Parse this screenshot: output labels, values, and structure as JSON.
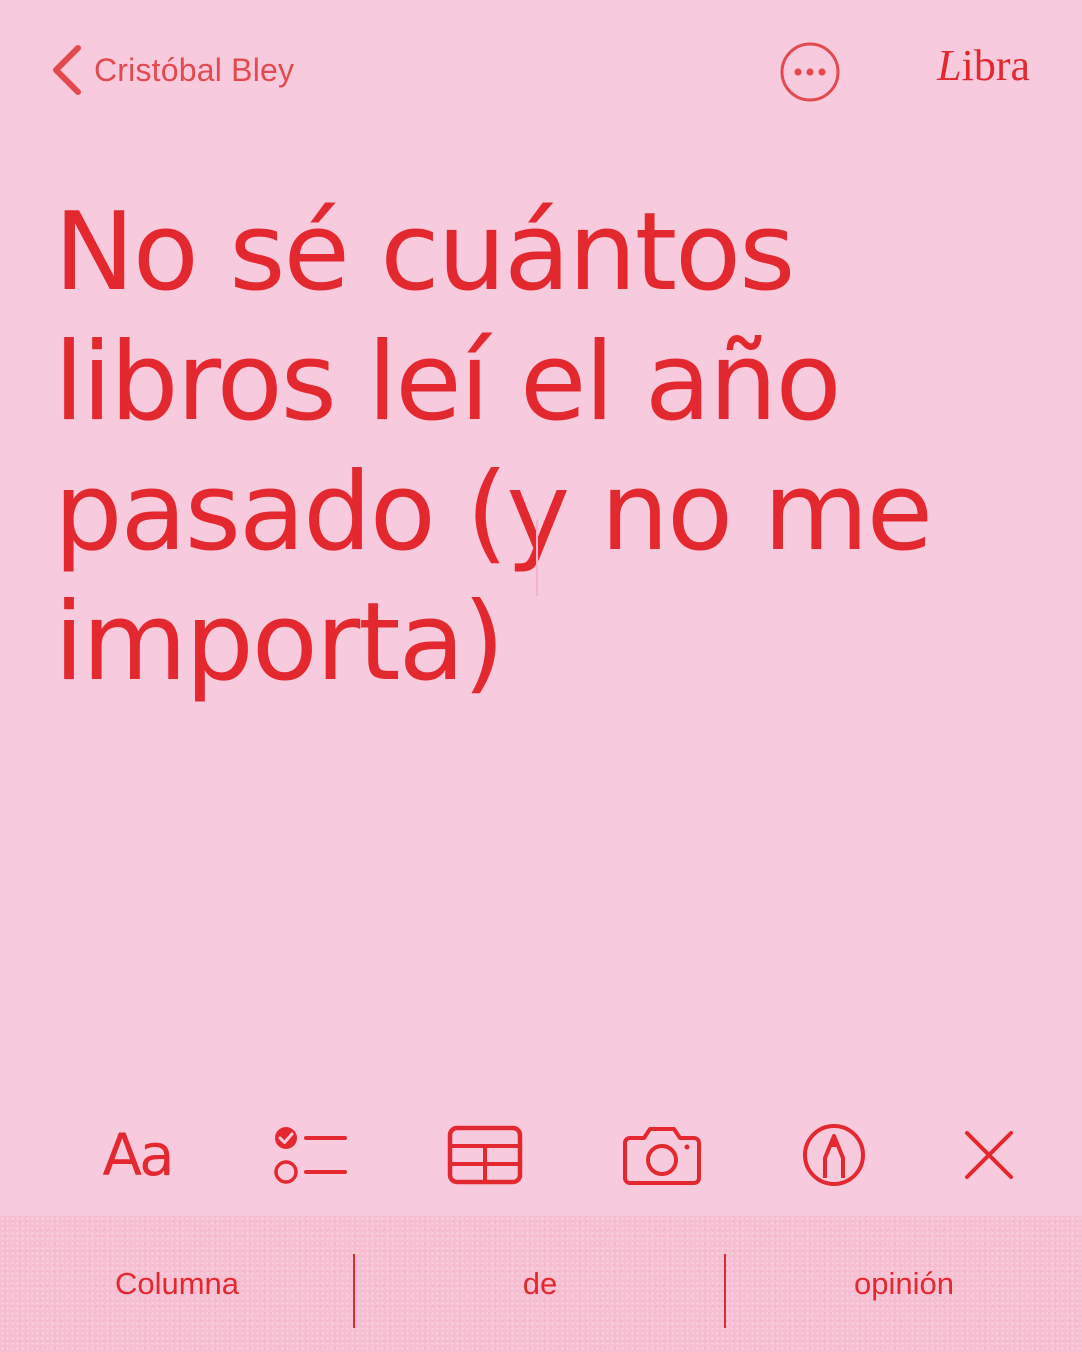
{
  "nav": {
    "back_label": "Cristóbal Bley",
    "more_icon": "ellipsis-circle-icon",
    "brand_initial": "L",
    "brand_rest": "ibra"
  },
  "note": {
    "title": "No sé cuántos libros leí el año pasado (y no me importa)"
  },
  "toolbar": {
    "format_label": "Aa",
    "icons": [
      "text-format-icon",
      "checklist-icon",
      "table-icon",
      "camera-icon",
      "markup-pen-icon",
      "close-icon"
    ]
  },
  "footer": {
    "items": [
      "Columna",
      "de",
      "opinión"
    ]
  },
  "colors": {
    "background": "#f8cadd",
    "accent": "#e3282f",
    "footer_background": "#f6bfd2"
  }
}
